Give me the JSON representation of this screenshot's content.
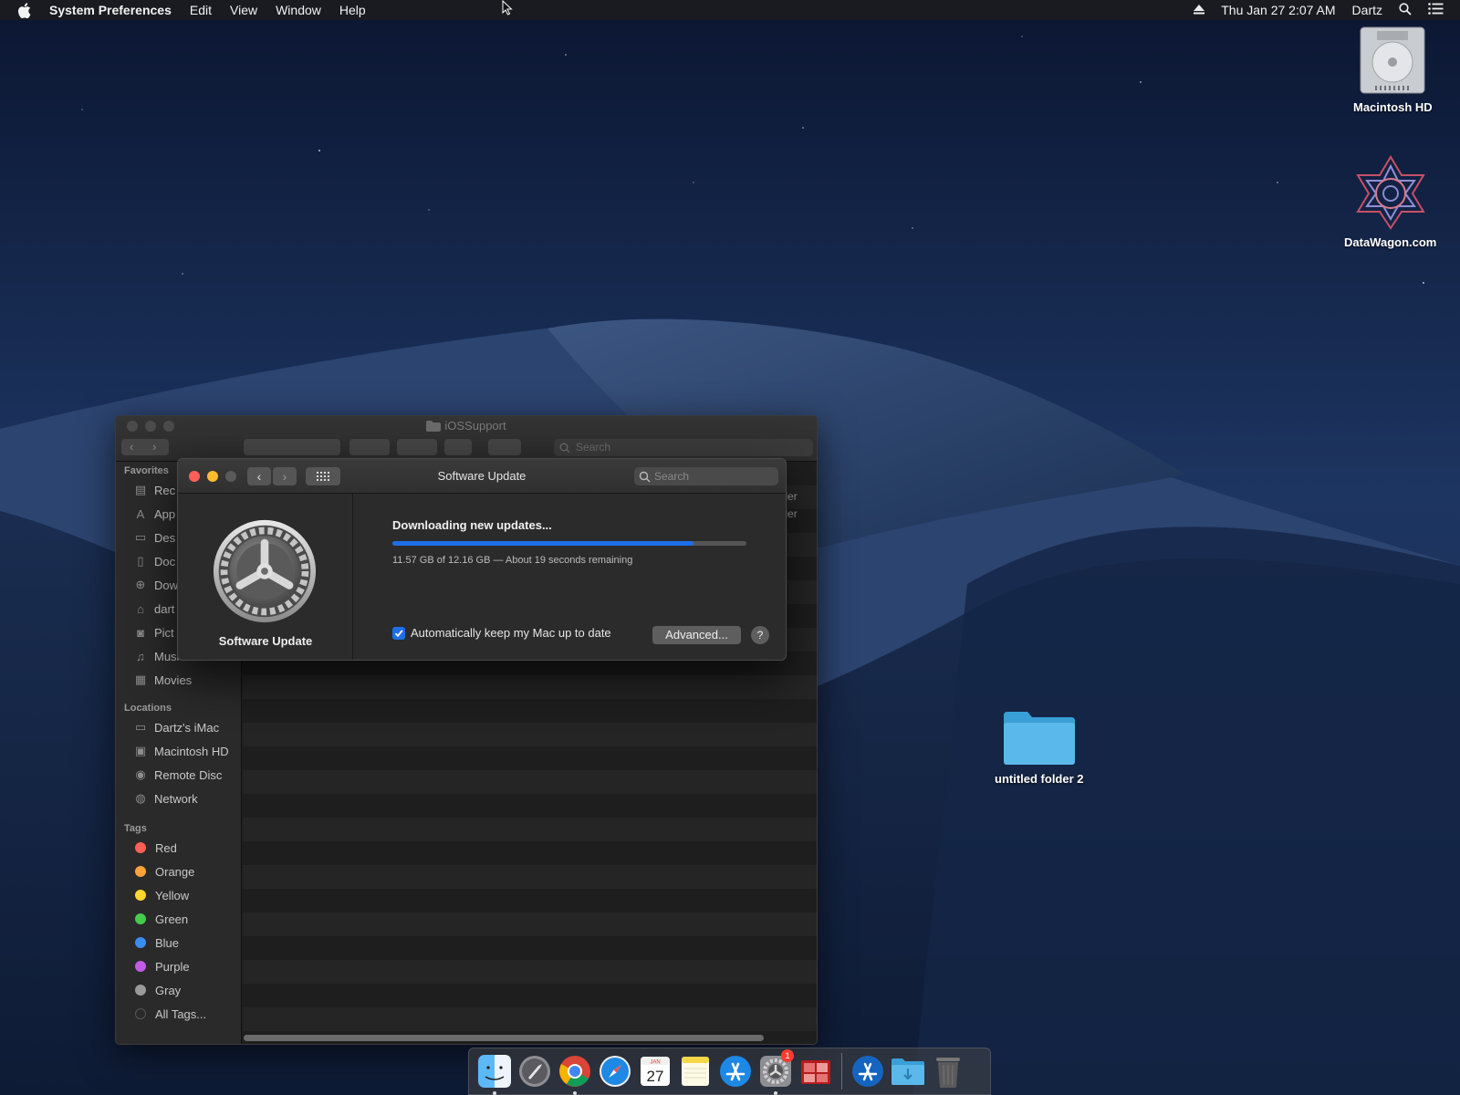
{
  "menubar": {
    "app_name": "System Preferences",
    "menus": [
      "Edit",
      "View",
      "Window",
      "Help"
    ],
    "datetime": "Thu Jan 27  2:07 AM",
    "user": "Dartz"
  },
  "desktop": {
    "icons": [
      {
        "label": "Macintosh HD",
        "icon": "hard-drive-icon"
      },
      {
        "label": "DataWagon.com",
        "icon": "datawagon-logo-icon"
      },
      {
        "label": "untitled folder 2",
        "icon": "folder-icon"
      }
    ]
  },
  "finder": {
    "title": "iOSSupport",
    "search_placeholder": "Search",
    "kind_header": "nd",
    "kind_rows": [
      "older",
      "older"
    ],
    "favorites_title": "Favorites",
    "favorites": [
      {
        "label": "Rec",
        "icon": "recents-icon"
      },
      {
        "label": "App",
        "icon": "applications-icon"
      },
      {
        "label": "Des",
        "icon": "desktop-icon"
      },
      {
        "label": "Doc",
        "icon": "documents-icon"
      },
      {
        "label": "Dow",
        "icon": "downloads-icon"
      },
      {
        "label": "dart",
        "icon": "home-icon"
      },
      {
        "label": "Pict",
        "icon": "pictures-icon"
      },
      {
        "label": "Music",
        "icon": "music-icon"
      },
      {
        "label": "Movies",
        "icon": "movies-icon"
      }
    ],
    "locations_title": "Locations",
    "locations": [
      {
        "label": "Dartz's iMac",
        "icon": "imac-icon"
      },
      {
        "label": "Macintosh HD",
        "icon": "disk-icon"
      },
      {
        "label": "Remote Disc",
        "icon": "remote-disc-icon"
      },
      {
        "label": "Network",
        "icon": "network-icon"
      }
    ],
    "tags_title": "Tags",
    "tags": [
      {
        "label": "Red",
        "color": "#fe5f57"
      },
      {
        "label": "Orange",
        "color": "#fca33a"
      },
      {
        "label": "Yellow",
        "color": "#fdd730"
      },
      {
        "label": "Green",
        "color": "#44cc4f"
      },
      {
        "label": "Blue",
        "color": "#3b8cf0"
      },
      {
        "label": "Purple",
        "color": "#c15ce6"
      },
      {
        "label": "Gray",
        "color": "#9a9a9a"
      },
      {
        "label": "All Tags...",
        "color": "#555555"
      }
    ]
  },
  "software_update": {
    "window_title": "Software Update",
    "search_placeholder": "Search",
    "pane_name": "Software Update",
    "status": "Downloading new updates...",
    "progress_fraction": 0.85,
    "detail": "11.57 GB of 12.16 GB — About 19 seconds remaining",
    "auto_update_label": "Automatically keep my Mac up to date",
    "auto_update_checked": true,
    "advanced_label": "Advanced...",
    "help_label": "?",
    "accent_color": "#1f6ee8"
  },
  "dock": {
    "items": [
      {
        "name": "finder-icon",
        "running": true
      },
      {
        "name": "launchpad-icon",
        "running": false
      },
      {
        "name": "chrome-icon",
        "running": true
      },
      {
        "name": "safari-icon",
        "running": false
      },
      {
        "name": "calendar-icon",
        "running": false,
        "month": "JAN",
        "day": "27"
      },
      {
        "name": "notes-icon",
        "running": false
      },
      {
        "name": "app-store-icon",
        "running": false
      },
      {
        "name": "system-preferences-icon",
        "running": true,
        "badge": "1"
      },
      {
        "name": "photo-booth-icon",
        "running": false
      }
    ],
    "right_items": [
      {
        "name": "app-store-folder-icon"
      },
      {
        "name": "downloads-folder-icon"
      },
      {
        "name": "trash-icon"
      }
    ]
  }
}
